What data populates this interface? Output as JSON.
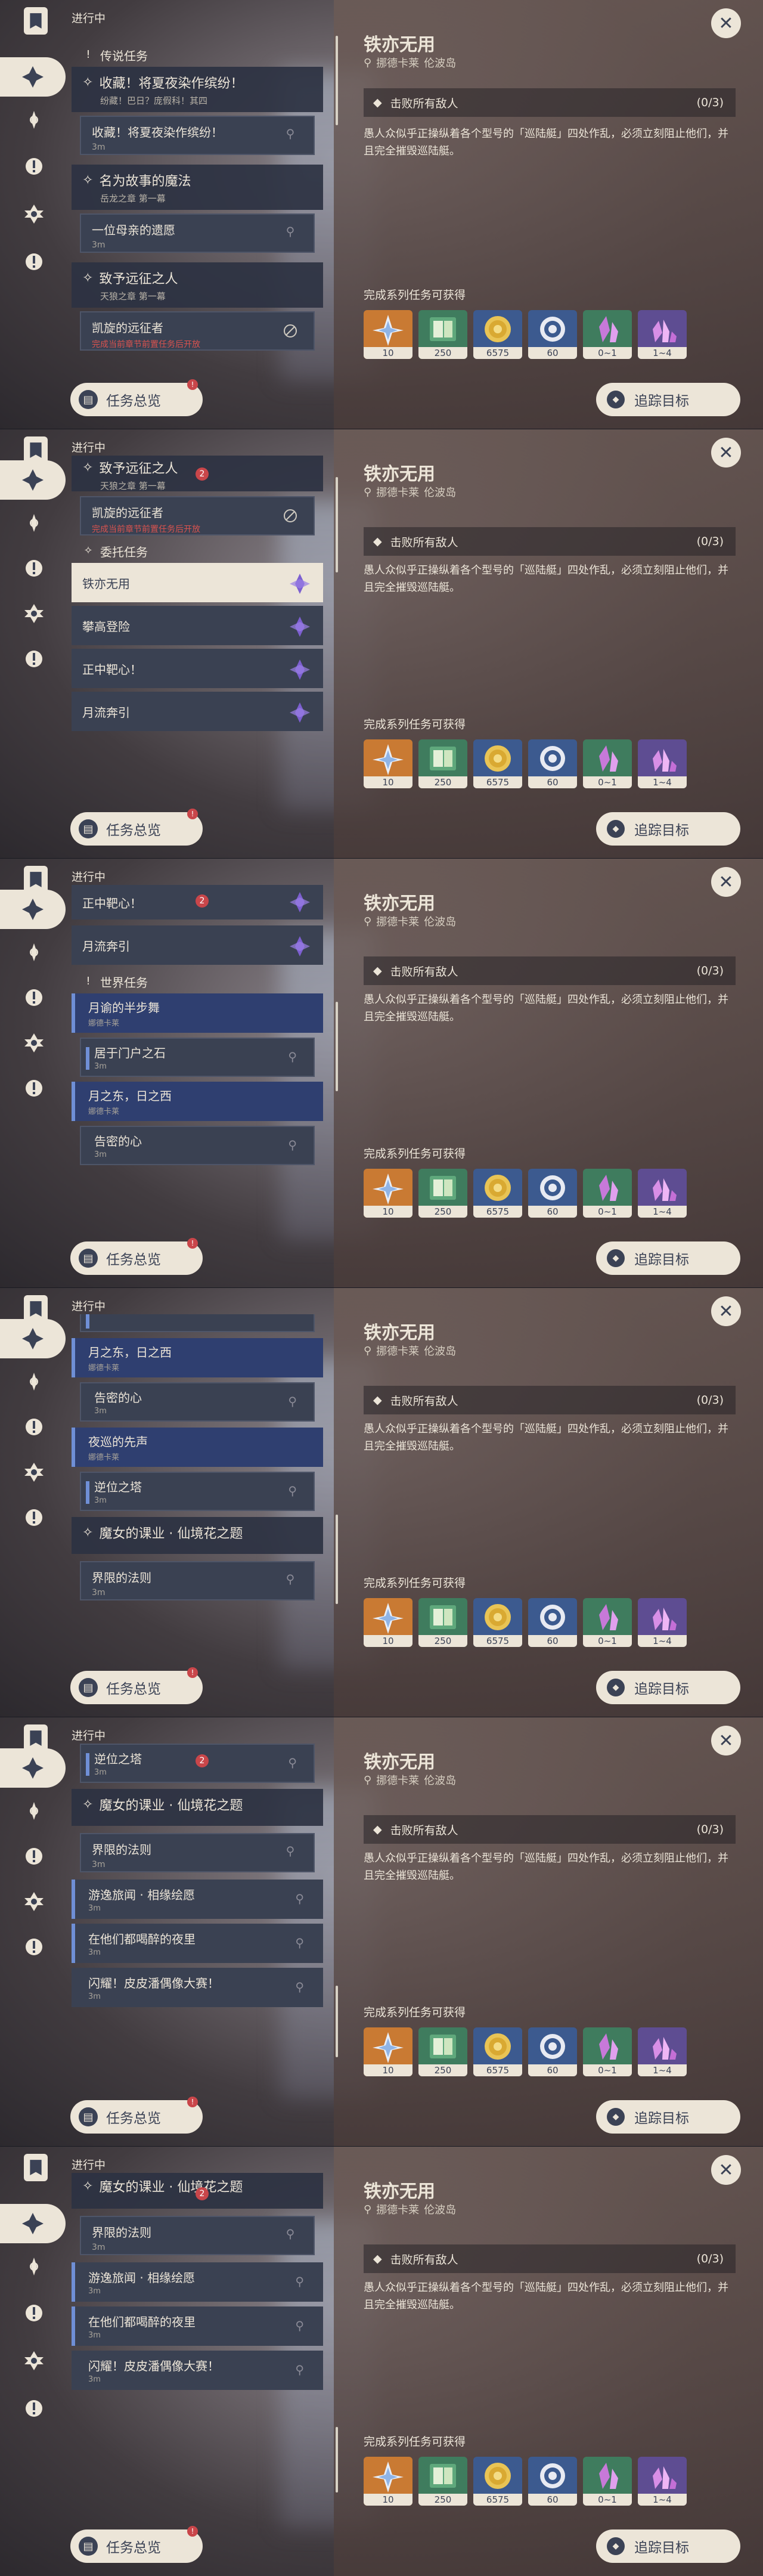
{
  "sidebar": {
    "section_label": "进行中"
  },
  "list": {
    "legend_header": "传说任务",
    "legend_main_title": "收藏！将夏夜染作缤纷！",
    "legend_main_sub": "纷藏！巴日？庞假科！其四",
    "legend_sub1_title": "收藏！将夏夜染作缤纷！",
    "legend_sub1_sub": "3m",
    "quest2_title": "名为故事的魔法",
    "quest2_sub": "岳龙之章 第一幕",
    "quest2_step_title": "一位母亲的遗愿",
    "quest2_step_sub": "3m",
    "quest3_title": "致予远征之人",
    "quest3_sub": "天狼之章 第一幕",
    "quest3_step_title": "凯旋的远征者",
    "quest3_step_sub": "完成当前章节前置任务后开放",
    "commission_header": "委托任务",
    "commissions": [
      "铁亦无用",
      "攀高登险",
      "正中靶心！",
      "月流奔引"
    ],
    "world_header": "世界任务",
    "world_a_title": "月谕的半步舞",
    "world_a_sub": "娜德卡莱",
    "world_a_step": "居于门户之石",
    "world_a_step_sub": "3m",
    "world_b_title": "月之东，日之西",
    "world_b_sub": "娜德卡莱",
    "world_b_step": "告密的心",
    "world_b_step_sub": "3m",
    "world_c_title": "夜巡的先声",
    "world_c_sub": "娜德卡莱",
    "world_c_step": "逆位之塔",
    "world_c_step_sub": "3m",
    "magic_title": "魔女的课业 · 仙境花之题",
    "magic_step": "界限的法则",
    "magic_step_sub": "3m",
    "events": [
      {
        "title": "游逸旅闻 · 相缘绘愿",
        "sub": "3m"
      },
      {
        "title": "在他们都喝醉的夜里",
        "sub": "3m"
      },
      {
        "title": "闪耀！皮皮潘偶像大赛！",
        "sub": "3m"
      }
    ],
    "badge": "2"
  },
  "buttons": {
    "overview": "任务总览",
    "overview_badge": "!",
    "track": "追踪目标",
    "close": "✕"
  },
  "detail": {
    "title": "铁亦无用",
    "location_region": "挪德卡莱",
    "location_place": "伦波岛",
    "objective": "击败所有敌人",
    "objective_count": "(0/3)",
    "description": "愚人众似乎正操纵着各个型号的「巡陆艇」四处作乱，必须立刻阻止他们，并且完全摧毁巡陆艇。",
    "rewards_header": "完成系列任务可获得",
    "rewards": [
      {
        "icon": "star-crystal-icon",
        "count": "10",
        "color": "#c97a33"
      },
      {
        "icon": "book-exp-icon",
        "count": "250",
        "color": "#3f7c5e"
      },
      {
        "icon": "mora-coin-icon",
        "count": "6575",
        "color": "#3c5a8f"
      },
      {
        "icon": "reputation-ring-icon",
        "count": "60",
        "color": "#3c5a8f"
      },
      {
        "icon": "crystal-shard-icon",
        "count": "0~1",
        "color": "#3f7c5e"
      },
      {
        "icon": "crystal-cluster-icon",
        "count": "1~4",
        "color": "#5e4d92"
      }
    ]
  },
  "accent": {
    "cream": "#ece5d8",
    "navy": "#3b4255",
    "blue": "#6f8fd6",
    "red": "#c9464a"
  }
}
